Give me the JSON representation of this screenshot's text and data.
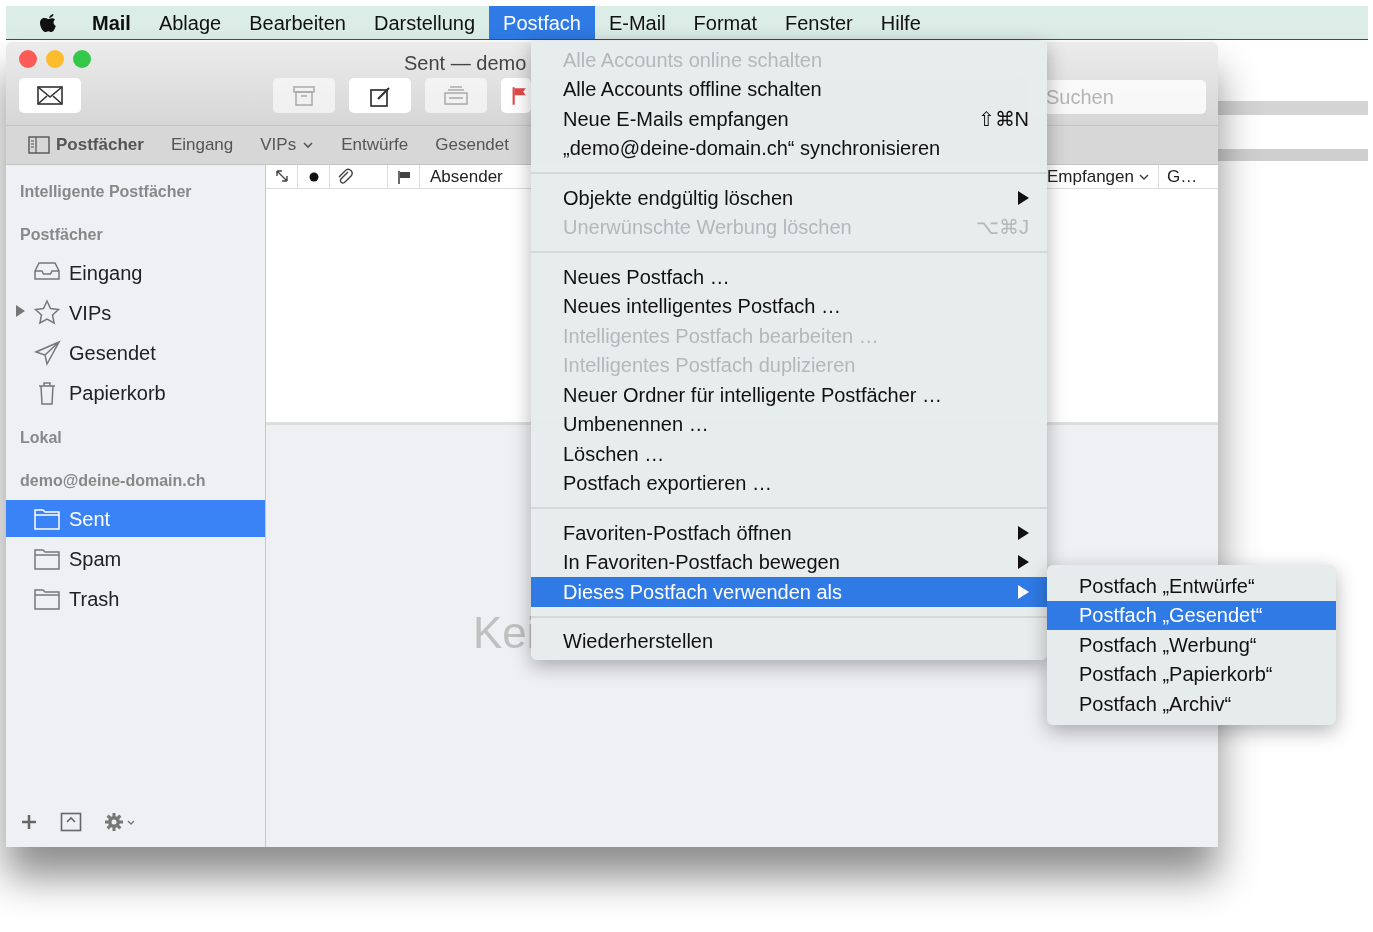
{
  "menubar": {
    "items": [
      {
        "label": "Mail",
        "bold": true,
        "selected": false
      },
      {
        "label": "Ablage",
        "bold": false,
        "selected": false
      },
      {
        "label": "Bearbeiten",
        "bold": false,
        "selected": false
      },
      {
        "label": "Darstellung",
        "bold": false,
        "selected": false
      },
      {
        "label": "Postfach",
        "bold": false,
        "selected": true
      },
      {
        "label": "E-Mail",
        "bold": false,
        "selected": false
      },
      {
        "label": "Format",
        "bold": false,
        "selected": false
      },
      {
        "label": "Fenster",
        "bold": false,
        "selected": false
      },
      {
        "label": "Hilfe",
        "bold": false,
        "selected": false
      }
    ]
  },
  "window": {
    "title": "Sent — demo",
    "toolbar": {
      "buttons": [
        {
          "kind": "envelope",
          "disabled": false
        },
        {
          "kind": "archive",
          "disabled": true
        },
        {
          "kind": "compose",
          "disabled": false
        },
        {
          "kind": "junk",
          "disabled": true
        },
        {
          "kind": "flag",
          "disabled": false
        }
      ],
      "search": {
        "placeholder": "Suchen"
      }
    },
    "favorites": [
      {
        "label": "Postfächer",
        "kind": "sidebar-toggle"
      },
      {
        "label": "Eingang",
        "kind": "plain"
      },
      {
        "label": "VIPs",
        "kind": "dropdown"
      },
      {
        "label": "Entwürfe",
        "kind": "plain"
      },
      {
        "label": "Gesendet",
        "kind": "plain"
      }
    ],
    "sidebar": [
      {
        "header": "Intelligente Postfächer"
      },
      {
        "header": "Postfächer",
        "items": [
          {
            "label": "Eingang",
            "kind": "inbox",
            "expandable": false,
            "selected": false
          },
          {
            "label": "VIPs",
            "kind": "star",
            "expandable": true,
            "selected": false
          },
          {
            "label": "Gesendet",
            "kind": "sent",
            "expandable": false,
            "selected": false
          },
          {
            "label": "Papierkorb",
            "kind": "trash",
            "expandable": false,
            "selected": false
          }
        ]
      },
      {
        "header": "Lokal"
      },
      {
        "header": "demo@deine-domain.ch",
        "items": [
          {
            "label": "Sent",
            "kind": "folder",
            "expandable": false,
            "selected": true
          },
          {
            "label": "Spam",
            "kind": "folder",
            "expandable": false,
            "selected": false
          },
          {
            "label": "Trash",
            "kind": "folder",
            "expandable": false,
            "selected": false
          }
        ]
      }
    ],
    "list_columns": [
      {
        "kind": "thread"
      },
      {
        "kind": "unread"
      },
      {
        "kind": "attachment"
      },
      {
        "kind": "flag"
      },
      {
        "kind": "text",
        "label": "Absender"
      }
    ],
    "list_columns_right": [
      {
        "label": "Empfangen",
        "sorted": true
      },
      {
        "label": "G…",
        "sorted": false
      }
    ],
    "empty_message": "Kei"
  },
  "menu": [
    {
      "kind": "item",
      "label": "Alle Accounts online schalten",
      "disabled": true,
      "selected": false
    },
    {
      "kind": "item",
      "label": "Alle Accounts offline schalten",
      "disabled": false,
      "selected": false
    },
    {
      "kind": "item",
      "label": "Neue E-Mails empfangen",
      "shortcut": "⇧⌘N",
      "disabled": false,
      "selected": false
    },
    {
      "kind": "item",
      "label": "„demo@deine-domain.ch“ synchronisieren",
      "disabled": false,
      "selected": false
    },
    {
      "kind": "separator"
    },
    {
      "kind": "item",
      "label": "Objekte endgültig löschen",
      "submenu": true,
      "disabled": false,
      "selected": false
    },
    {
      "kind": "item",
      "label": "Unerwünschte Werbung löschen",
      "shortcut": "⌥⌘J",
      "disabled": true,
      "selected": false
    },
    {
      "kind": "separator"
    },
    {
      "kind": "item",
      "label": "Neues Postfach …",
      "disabled": false,
      "selected": false
    },
    {
      "kind": "item",
      "label": "Neues intelligentes Postfach …",
      "disabled": false,
      "selected": false
    },
    {
      "kind": "item",
      "label": "Intelligentes Postfach bearbeiten …",
      "disabled": true,
      "selected": false
    },
    {
      "kind": "item",
      "label": "Intelligentes Postfach duplizieren",
      "disabled": true,
      "selected": false
    },
    {
      "kind": "item",
      "label": "Neuer Ordner für intelligente Postfächer …",
      "disabled": false,
      "selected": false
    },
    {
      "kind": "item",
      "label": "Umbenennen …",
      "disabled": false,
      "selected": false
    },
    {
      "kind": "item",
      "label": "Löschen …",
      "disabled": false,
      "selected": false
    },
    {
      "kind": "item",
      "label": "Postfach exportieren …",
      "disabled": false,
      "selected": false
    },
    {
      "kind": "separator"
    },
    {
      "kind": "item",
      "label": "Favoriten-Postfach öffnen",
      "submenu": true,
      "disabled": false,
      "selected": false
    },
    {
      "kind": "item",
      "label": "In Favoriten-Postfach bewegen",
      "submenu": true,
      "disabled": false,
      "selected": false
    },
    {
      "kind": "item",
      "label": "Dieses Postfach verwenden als",
      "submenu": true,
      "disabled": false,
      "selected": true
    },
    {
      "kind": "separator"
    },
    {
      "kind": "item",
      "label": "Wiederherstellen",
      "disabled": false,
      "selected": false
    }
  ],
  "submenu": [
    {
      "label": "Postfach „Entwürfe“",
      "selected": false
    },
    {
      "label": "Postfach „Gesendet“",
      "selected": true
    },
    {
      "label": "Postfach „Werbung“",
      "selected": false
    },
    {
      "label": "Postfach „Papierkorb“",
      "selected": false
    },
    {
      "label": "Postfach „Archiv“",
      "selected": false
    }
  ]
}
